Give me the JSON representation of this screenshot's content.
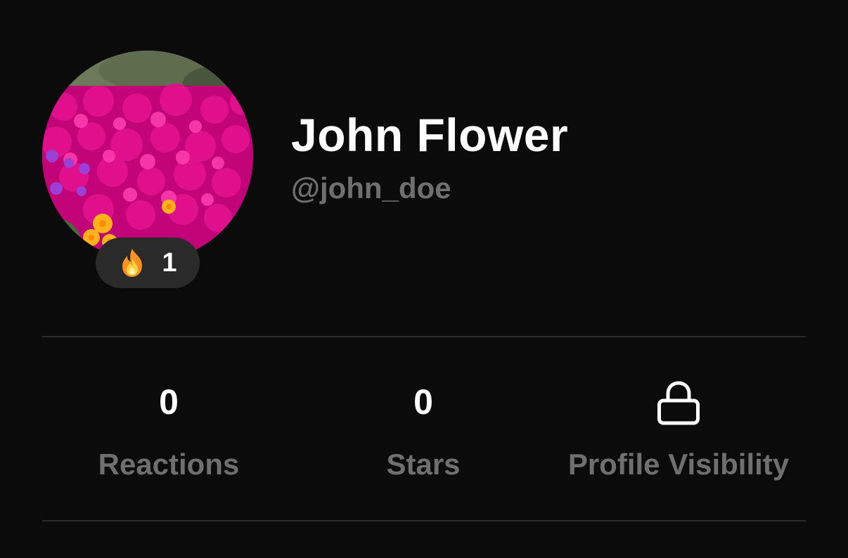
{
  "profile": {
    "display_name": "John Flower",
    "handle": "@john_doe",
    "streak": {
      "icon": "fire-icon",
      "count": "1"
    }
  },
  "stats": {
    "reactions": {
      "value": "0",
      "label": "Reactions"
    },
    "stars": {
      "value": "0",
      "label": "Stars"
    },
    "visibility": {
      "icon": "lock-icon",
      "label": "Profile Visibility"
    }
  },
  "colors": {
    "background": "#0b0b0b",
    "text_primary": "#ffffff",
    "text_secondary": "#6f6f6f",
    "divider": "#2b2b2b",
    "badge_bg": "#2a2a2a"
  }
}
